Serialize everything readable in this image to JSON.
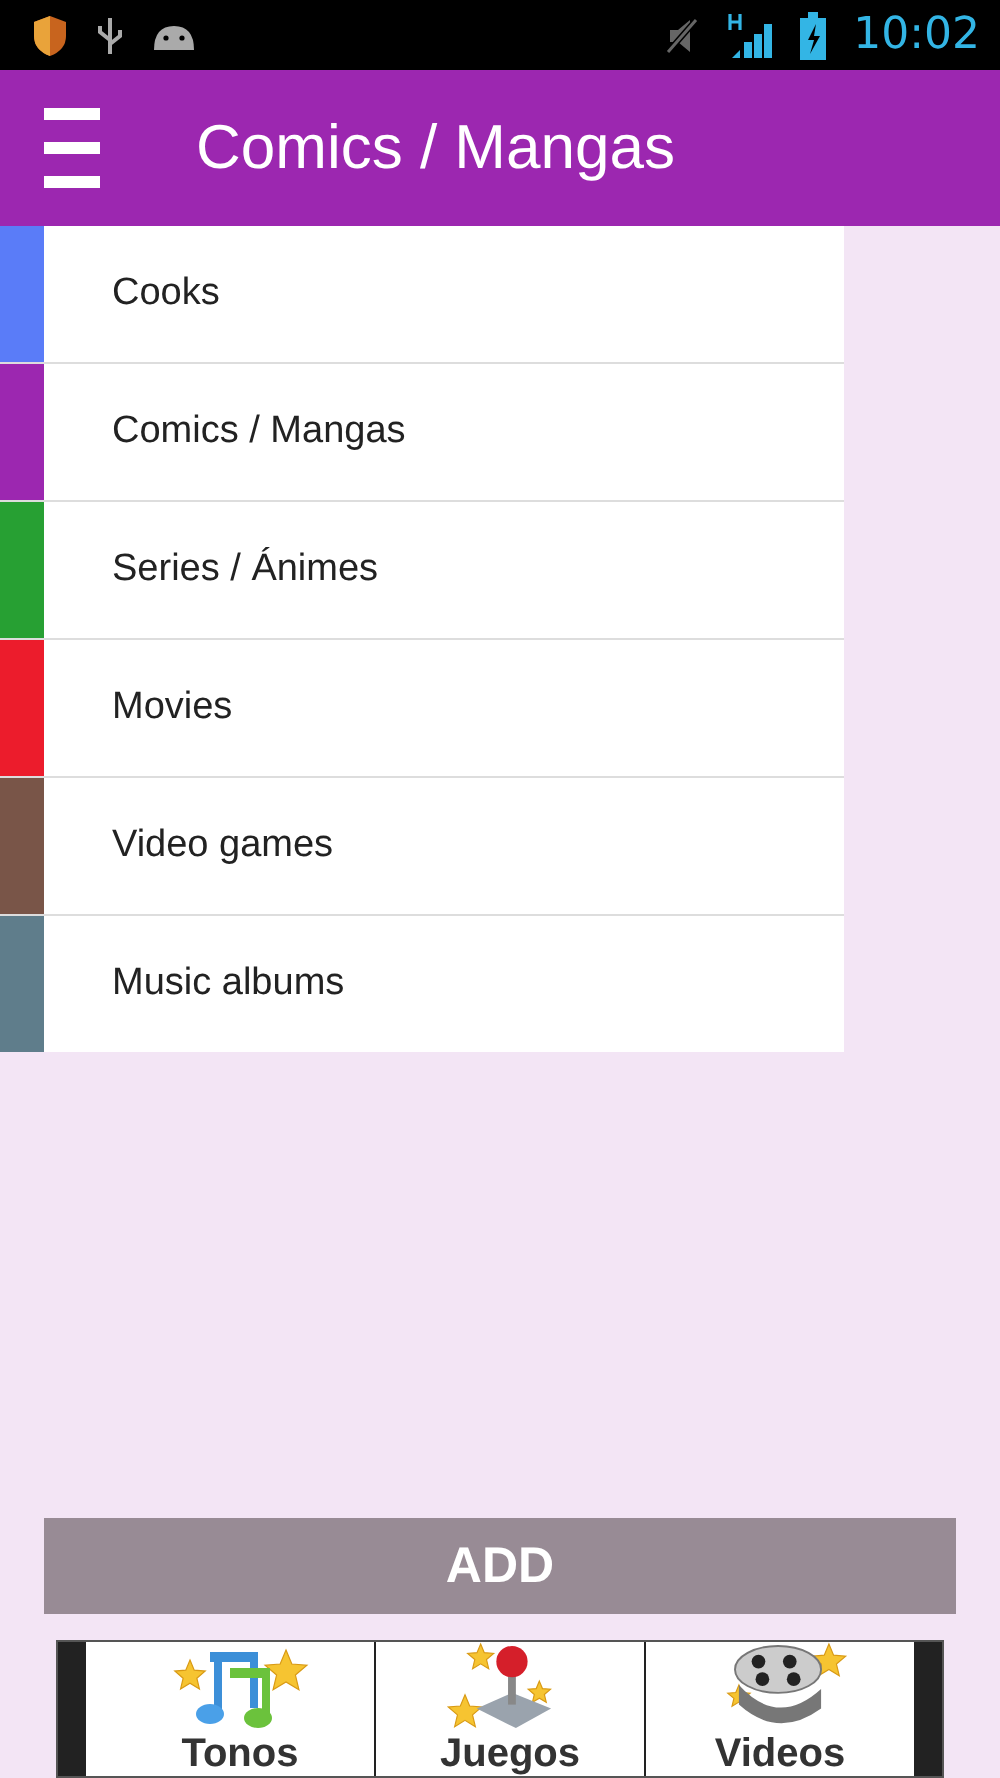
{
  "status_bar": {
    "time": "10:02"
  },
  "app_bar": {
    "title": "Comics / Mangas"
  },
  "categories": [
    {
      "label": "Cooks",
      "color": "#5a7cf8"
    },
    {
      "label": "Comics / Mangas",
      "color": "#9c27b0"
    },
    {
      "label": "Series / Ánimes",
      "color": "#27a033"
    },
    {
      "label": "Movies",
      "color": "#ec1c2c"
    },
    {
      "label": "Video games",
      "color": "#795548"
    },
    {
      "label": "Music albums",
      "color": "#5f7d8b"
    }
  ],
  "add_button": {
    "label": "ADD"
  },
  "ad_banner": {
    "items": [
      {
        "kind": "music",
        "label": "Tonos"
      },
      {
        "kind": "games",
        "label": "Juegos"
      },
      {
        "kind": "videos",
        "label": "Videos"
      }
    ]
  }
}
